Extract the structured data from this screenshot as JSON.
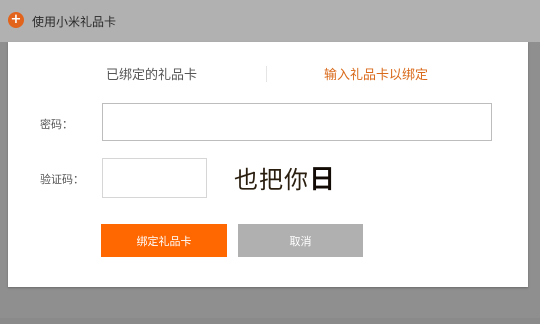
{
  "top": {
    "icon": "plus-circle-icon",
    "title": "使用小米礼品卡"
  },
  "tabs": {
    "bound": "已绑定的礼品卡",
    "input": "输入礼品卡以绑定",
    "active_color": "#d96a1b"
  },
  "form": {
    "password_label": "密码：",
    "password_value": "",
    "captcha_label": "验证码：",
    "captcha_value": "",
    "captcha_chars": [
      "也",
      "把",
      "你",
      "日"
    ]
  },
  "buttons": {
    "bind": "绑定礼品卡",
    "cancel": "取消",
    "bind_color": "#ff6700",
    "cancel_color": "#b0b0b0"
  }
}
